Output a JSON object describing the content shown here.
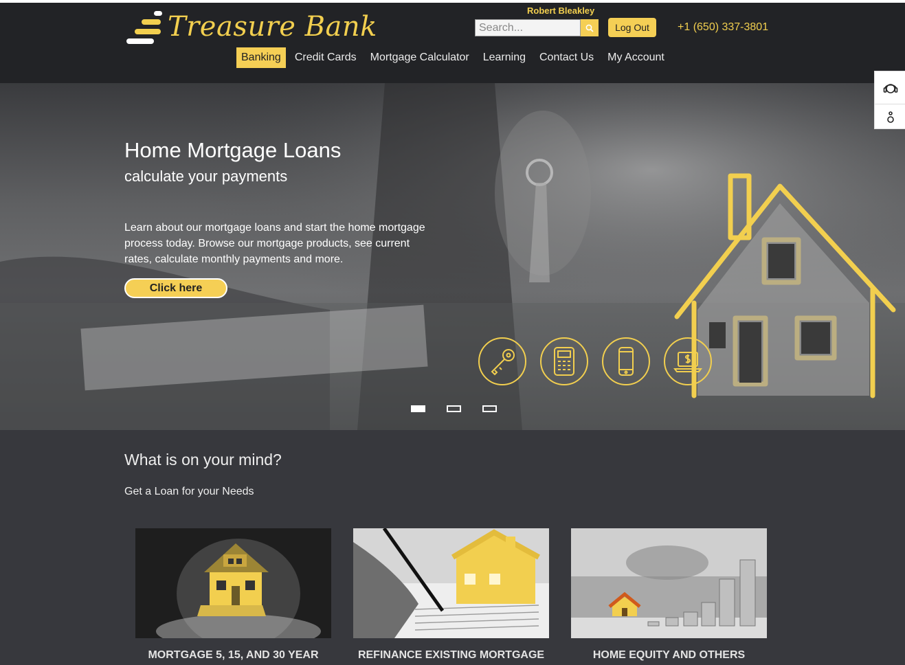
{
  "header": {
    "logo_text": "Treasure Bank",
    "user_name": "Robert Bleakley",
    "search_placeholder": "Search...",
    "logout_label": "Log Out",
    "phone": "+1 (650) 337-3801"
  },
  "nav": {
    "items": [
      {
        "label": "Banking",
        "active": true
      },
      {
        "label": "Credit Cards"
      },
      {
        "label": "Mortgage Calculator"
      },
      {
        "label": "Learning"
      },
      {
        "label": "Contact Us"
      },
      {
        "label": "My Account"
      }
    ]
  },
  "hero": {
    "title": "Home Mortgage Loans",
    "subtitle": "calculate your payments",
    "body": "Learn about our mortgage loans and start the home mortgage process today. Browse our mortgage products, see current rates, calculate monthly payments and more.",
    "cta_label": "Click here",
    "icons": [
      "key-icon",
      "calculator-icon",
      "mobile-phone-icon",
      "laptop-dollar-icon"
    ],
    "slides": {
      "count": 3,
      "active": 1
    }
  },
  "side_tools": {
    "icons": [
      "headset-icon",
      "accessibility-icon"
    ]
  },
  "section": {
    "title": "What is on your mind?",
    "subtitle": "Get a Loan for your Needs",
    "cards": [
      {
        "label": "MORTGAGE 5, 15, AND 30 YEAR"
      },
      {
        "label": "REFINANCE EXISTING MORTGAGE"
      },
      {
        "label": "HOME EQUITY AND OTHERS"
      }
    ]
  },
  "colors": {
    "accent": "#f5cf55",
    "header_bg": "#222326",
    "page_bg": "#37383d"
  }
}
